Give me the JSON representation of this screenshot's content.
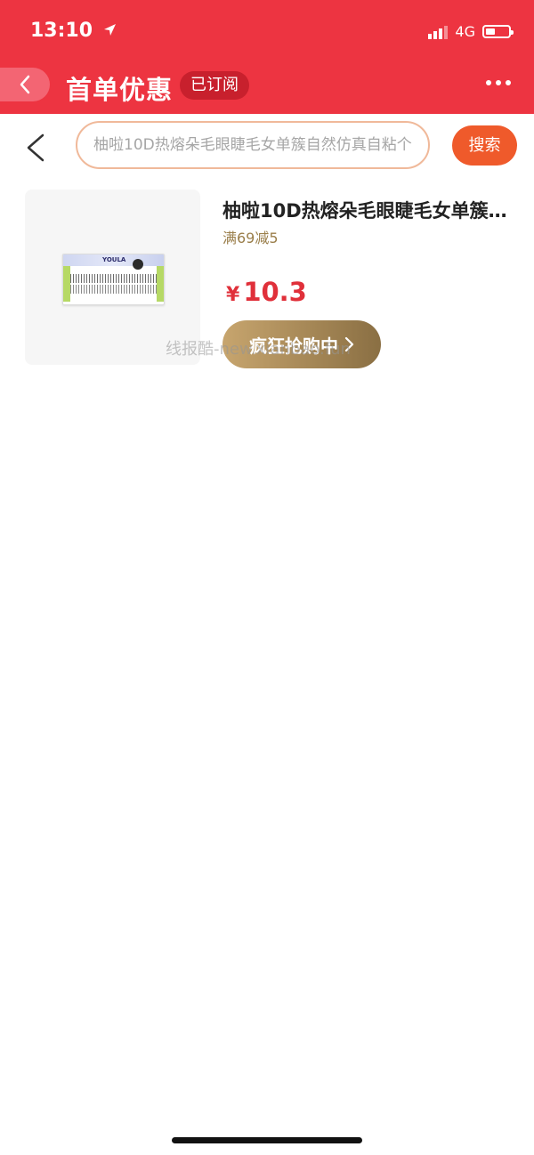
{
  "status_bar": {
    "time": "13:10",
    "network": "4G",
    "location_icon": "location-arrow-icon",
    "signal_icon": "cellular-signal-icon",
    "battery_icon": "battery-icon"
  },
  "header": {
    "title": "首单优惠",
    "subscribe_badge": "已订阅",
    "back_icon": "chevron-left-icon",
    "more_icon": "more-dots-icon",
    "background_color": "#ed3441"
  },
  "search": {
    "back_icon": "chevron-left-icon",
    "value": "柚啦10D热熔朵毛眼睫毛女单簇自然仿真自粘个",
    "button_label": "搜索",
    "button_color": "#ef5a2b"
  },
  "products": [
    {
      "title": "柚啦10D热熔朵毛眼睫毛女单簇自然仿真自粘个",
      "promo": "满69减5",
      "currency": "¥",
      "price": "10.3",
      "buy_label": "疯狂抢购中",
      "buy_icon": "chevron-right-icon",
      "image_brand": "YOULA"
    }
  ],
  "watermark": "线报酷-new.xianbao.fun"
}
